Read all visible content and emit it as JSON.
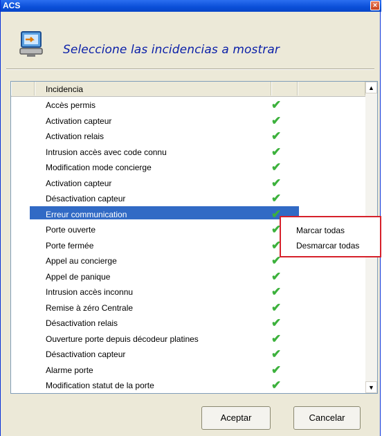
{
  "window": {
    "title": "ACS",
    "close_label": "×"
  },
  "header": {
    "text": "Seleccione las incidencias a mostrar"
  },
  "list": {
    "column_header": "Incidencia",
    "rows": [
      "Accès permis",
      "Activation capteur",
      "Activation relais",
      "Intrusion accès avec code connu",
      "Modification mode concierge",
      "Activation capteur",
      "Désactivation capteur",
      "Erreur communication",
      "Porte ouverte",
      "Porte fermée",
      "Appel au concierge",
      "Appel de panique",
      "Intrusion accès inconnu",
      "Remise à zéro Centrale",
      "Désactivation relais",
      "Ouverture porte depuis décodeur platines",
      "Désactivation capteur",
      "Alarme porte",
      "Modification statut de la porte"
    ],
    "check_glyph": "✔",
    "selected_index": 7
  },
  "scrollbar": {
    "up_glyph": "▲",
    "down_glyph": "▼"
  },
  "context_menu": {
    "items": [
      "Marcar todas",
      "Desmarcar todas"
    ]
  },
  "buttons": {
    "accept": "Aceptar",
    "cancel": "Cancelar"
  }
}
